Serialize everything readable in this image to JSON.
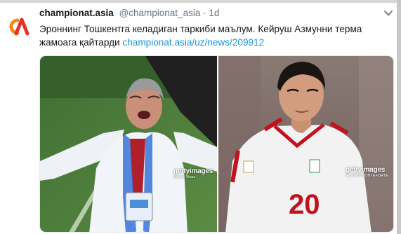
{
  "tweet": {
    "author_name": "championat.asia",
    "handle": "@championat_asia",
    "separator": "·",
    "time": "1d",
    "text": "Эроннинг Тошкентга келадиган таркиби маълум. Кейруш Азмунни терма жамоага қайтарди",
    "link": "championat.asia/uz/news/209912"
  },
  "icons": {
    "avatar": "championat-logo-icon",
    "menu": "chevron-down-icon"
  },
  "colors": {
    "link": "#1b95e0",
    "handle": "#657786",
    "logo_orange": "#f28a1d",
    "logo_red": "#e4322b"
  },
  "media": {
    "left": {
      "watermark": "gettyimages",
      "credit": "Héctor Vivas"
    },
    "right": {
      "watermark": "gettyimages",
      "credit": "FILIPPO MONTEFORTE"
    }
  }
}
